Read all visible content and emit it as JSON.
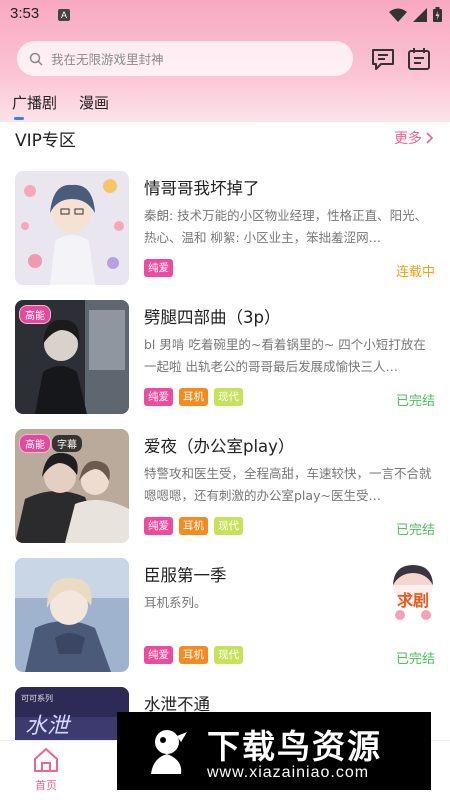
{
  "status_bar": {
    "time": "3:53",
    "notification": "A"
  },
  "search": {
    "placeholder": "我在无限游戏里封神"
  },
  "tabs": [
    {
      "label": "广播剧",
      "active": true
    },
    {
      "label": "漫画",
      "active": false
    }
  ],
  "section": {
    "title": "VIP专区",
    "more_label": "更多"
  },
  "items": [
    {
      "title": "情哥哥我坏掉了",
      "description": "秦朗: 技术万能的小区物业经理，性格正直、阳光、热心、温和 柳絮: 小区业主，笨拙羞涩网…",
      "badges": [],
      "tags": [
        "纯爱"
      ],
      "status": "连载中"
    },
    {
      "title": "劈腿四部曲（3p）",
      "description": "bl 男啃 吃着碗里的~看着锅里的~ 四个小短打放在一起啦 出轨老公的哥哥最后发展成愉快三人…",
      "badges": [
        "高能"
      ],
      "tags": [
        "纯爱",
        "耳机",
        "现代"
      ],
      "status": "已完结"
    },
    {
      "title": "爱夜（办公室play）",
      "description": "特警攻和医生受，全程高甜，车速较快，一言不合就嗯嗯嗯，还有刺激的办公室play~医生受…",
      "badges": [
        "高能",
        "字幕"
      ],
      "tags": [
        "纯爱",
        "耳机",
        "现代"
      ],
      "status": "已完结"
    },
    {
      "title": "臣服第一季",
      "description": "耳机系列。",
      "badges": [],
      "tags": [
        "纯爱",
        "耳机",
        "现代"
      ],
      "status": "已完结"
    },
    {
      "title": "水泄不通",
      "description": "",
      "badges": [],
      "tags": [],
      "status": ""
    }
  ],
  "cover5_text": {
    "small": "可可系列",
    "big": "水泄"
  },
  "float_button": {
    "label": "求剧"
  },
  "bottom_nav": {
    "home_label": "首页"
  },
  "watermark": {
    "text": "下载鸟资源",
    "url": "www.xiazainiao.com"
  },
  "colors": {
    "accent_pink": "#f06292",
    "tag_pink": "#ec4ba0",
    "tag_orange": "#f58a20",
    "tag_green": "#c6e25a",
    "status_orange": "#f3a21a",
    "status_green": "#4cc25a"
  }
}
